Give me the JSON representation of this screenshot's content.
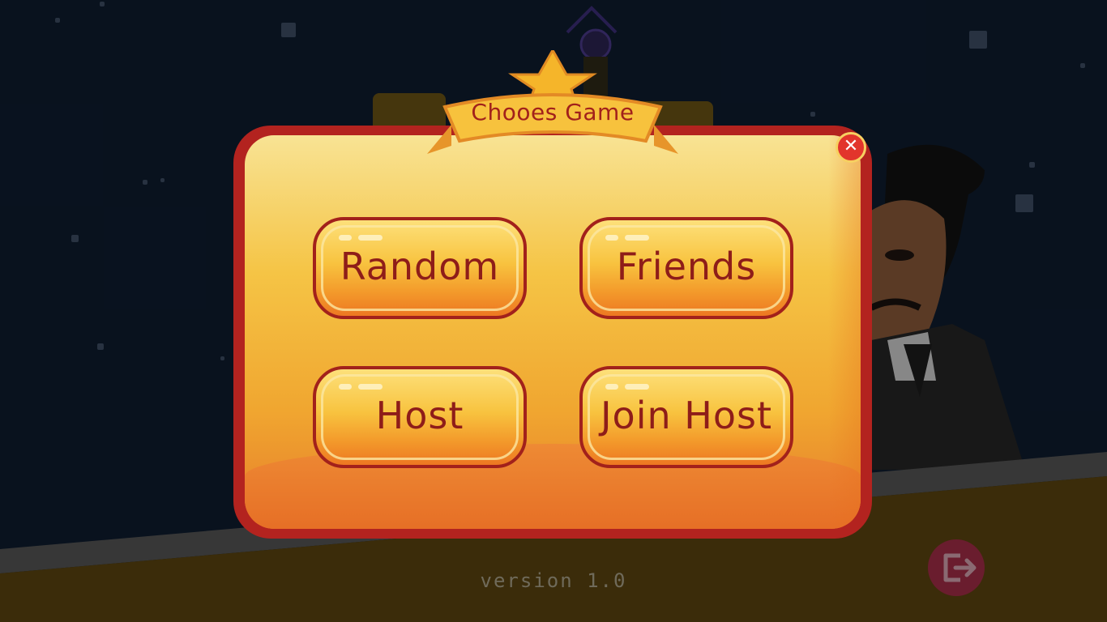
{
  "dialog": {
    "title": "Chooes Game",
    "close_icon": "close-icon"
  },
  "buttons": [
    {
      "label": "Random"
    },
    {
      "label": "Friends"
    },
    {
      "label": "Host"
    },
    {
      "label": "Join Host"
    }
  ],
  "footer": {
    "version": "version 1.0",
    "exit_icon": "exit-icon"
  },
  "colors": {
    "frame": "#b3231f",
    "panel": "#f5c445",
    "button_text": "#8e1d19",
    "close": "#e2352c",
    "sky": "#0e1c2f",
    "ground": "#5b4410"
  }
}
